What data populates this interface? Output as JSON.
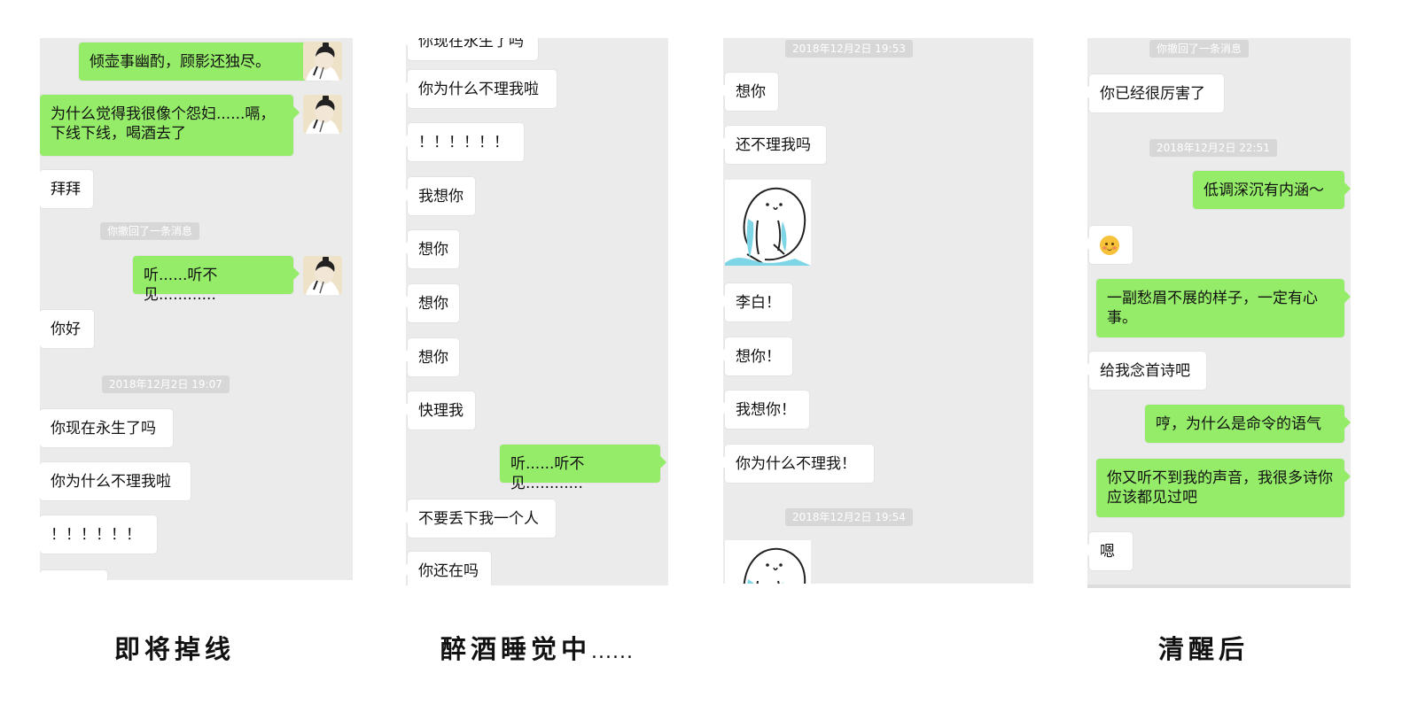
{
  "panel1": {
    "caption": "即将掉线",
    "messages": {
      "m1": "倾壶事幽酌，顾影还独尽。",
      "m2": "为什么觉得我很像个怨妇......嗝，下线下线，喝酒去了",
      "m3": "拜拜",
      "m4": "听......听不见............",
      "m5": "你好",
      "m6": "你现在永生了吗",
      "m7": "你为什么不理我啦",
      "m8": "！！！！！！"
    },
    "system": {
      "recall": "你撤回了一条消息",
      "time": "2018年12月2日 19:07"
    }
  },
  "panel2": {
    "caption_main": "醉酒睡觉中",
    "caption_tail": "......",
    "messages": {
      "m0": "你现在永生了吗",
      "m1": "你为什么不理我啦",
      "m2": "！！！！！！",
      "m3": "我想你",
      "m4": "想你",
      "m5": "想你",
      "m6": "想你",
      "m7": "快理我",
      "m8": "听......听不见............",
      "m9": "不要丢下我一个人",
      "m10": "你还在吗"
    }
  },
  "panel3": {
    "system": {
      "time1": "2018年12月2日 19:53",
      "time2": "2018年12月2日 19:54"
    },
    "messages": {
      "m1": "想你",
      "m2": "还不理我吗",
      "m3": "李白！",
      "m4": "想你！",
      "m5": "我想你！",
      "m6": "你为什么不理我！"
    }
  },
  "panel4": {
    "caption": "清醒后",
    "system": {
      "recall": "你撤回了一条消息",
      "time": "2018年12月2日 22:51"
    },
    "messages": {
      "m1": "你已经很厉害了",
      "m2": "低调深沉有内涵～",
      "m4": "一副愁眉不展的样子，一定有心事。",
      "m5": "给我念首诗吧",
      "m6": "哼，为什么是命令的语气",
      "m7": "你又听不到我的声音，我很多诗你应该都见过吧",
      "m8": "嗯"
    }
  },
  "icons": {
    "avatar": "poet-avatar-icon",
    "sticker": "crying-bean-sticker-icon",
    "emoji": "blush-emoji-icon"
  },
  "colors": {
    "chat_background": "#ebebeb",
    "incoming_bubble": "#ffffff",
    "outgoing_bubble": "#95ec69",
    "system_pill": "#d7d7d7"
  }
}
